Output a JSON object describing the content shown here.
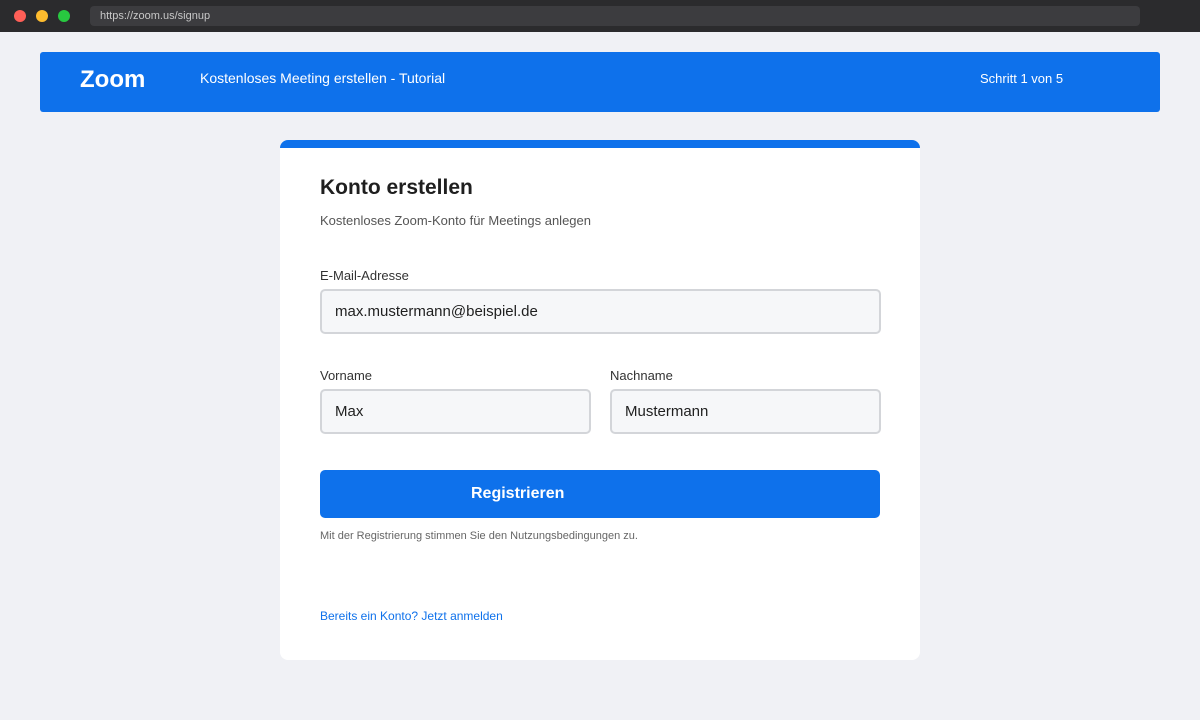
{
  "browser": {
    "url": "https://zoom.us/signup"
  },
  "header": {
    "logo": "Zoom",
    "title": "Kostenloses Meeting erstellen - Tutorial",
    "step": "Schritt 1 von 5",
    "color": "#0e71eb"
  },
  "form": {
    "title": "Konto erstellen",
    "subtitle": "Kostenloses Zoom-Konto für Meetings anlegen",
    "email": {
      "label": "E-Mail-Adresse",
      "value": "max.mustermann@beispiel.de"
    },
    "first_name": {
      "label": "Vorname",
      "value": "Max"
    },
    "last_name": {
      "label": "Nachname",
      "value": "Mustermann"
    },
    "submit_label": "Registrieren",
    "terms": "Mit der Registrierung stimmen Sie den Nutzungsbedingungen zu.",
    "login_link": "Bereits ein Konto? Jetzt anmelden"
  }
}
